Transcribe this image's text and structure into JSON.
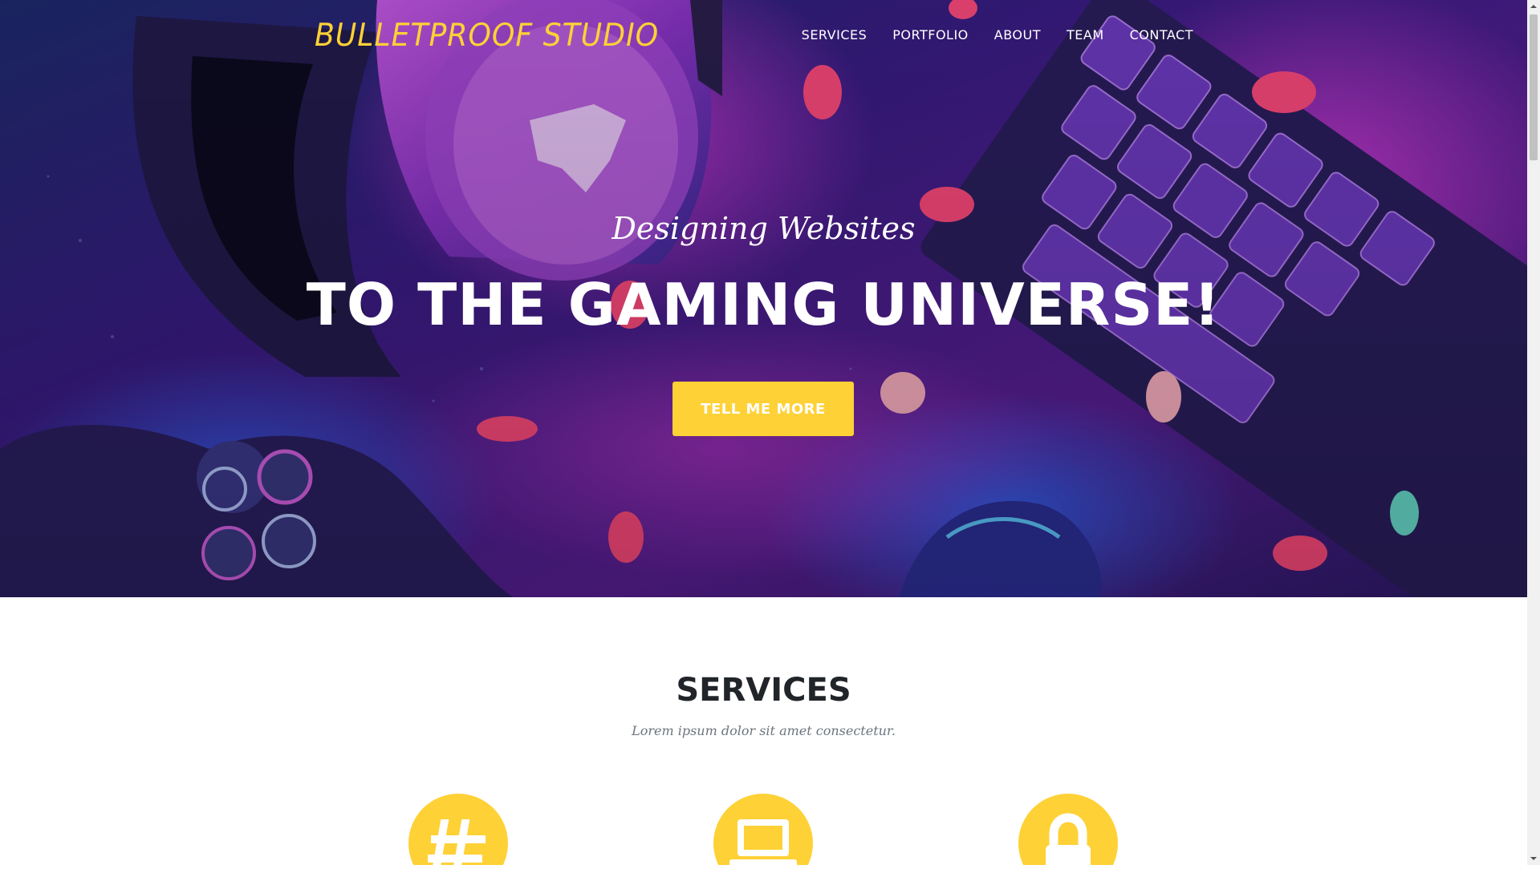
{
  "brand": {
    "name": "BULLETPROOF STUDIO"
  },
  "nav": {
    "items": [
      {
        "label": "SERVICES"
      },
      {
        "label": "PORTFOLIO"
      },
      {
        "label": "ABOUT"
      },
      {
        "label": "TEAM"
      },
      {
        "label": "CONTACT"
      }
    ]
  },
  "hero": {
    "subheading": "Designing Websites",
    "heading": "TO THE GAMING UNIVERSE!",
    "button_label": "TELL ME MORE"
  },
  "services": {
    "title": "SERVICES",
    "subtitle": "Lorem ipsum dolor sit amet consectetur.",
    "icons": [
      "hashtag-icon",
      "laptop-icon",
      "lock-icon"
    ]
  },
  "colors": {
    "accent": "#fed136",
    "heading_text": "#212529",
    "muted_text": "#6c757d"
  }
}
